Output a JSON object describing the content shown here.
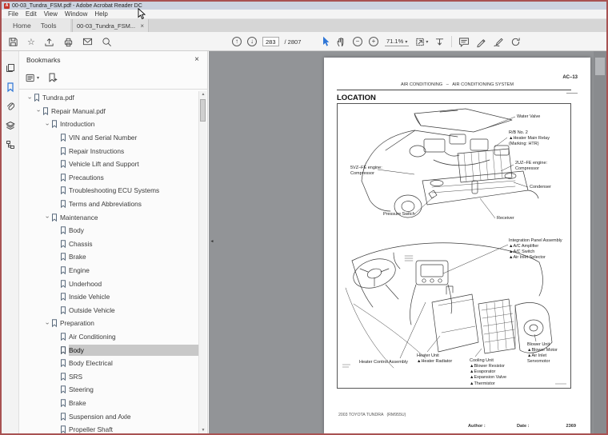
{
  "window": {
    "title": "00-03_Tundra_FSM.pdf - Adobe Acrobat Reader DC",
    "logo_letter": "A"
  },
  "menu_bar": {
    "items": [
      "File",
      "Edit",
      "View",
      "Window",
      "Help"
    ]
  },
  "tab_bar": {
    "home": "Home",
    "tools": "Tools",
    "document_tab": "00-03_Tundra_FSM...",
    "close_glyph": "×"
  },
  "toolbar": {
    "page_current": "283",
    "page_total": "/ 2807",
    "zoom_level": "71.1%"
  },
  "icons": {
    "close": "×",
    "caret_down": "▾",
    "chevron": "›",
    "arrow_up": "↑",
    "arrow_down": "↓",
    "minus": "−",
    "plus": "+",
    "star": "☆",
    "tri_up": "▲",
    "tri_down": "▼",
    "collapse_left": "◄"
  },
  "bookmarks": {
    "title": "Bookmarks",
    "items": [
      "Tundra.pdf",
      "Repair Manual.pdf",
      "Introduction",
      "VIN and Serial Number",
      "Repair Instructions",
      "Vehicle Lift and Support",
      "Precautions",
      "Troubleshooting ECU Systems",
      "Terms and Abbreviations",
      "Maintenance",
      "Body",
      "Chassis",
      "Brake",
      "Engine",
      "Underhood",
      "Inside Vehicle",
      "Outside Vehicle",
      "Preparation",
      "Air Conditioning",
      "Body",
      "Body Electrical",
      "SRS",
      "Steering",
      "Brake",
      "Suspension and Axle",
      "Propeller Shaft"
    ],
    "selected_item": "Body"
  },
  "document": {
    "page_code": "AC–13",
    "header": "AIR CONDITIONING   –   AIR CONDITIONING SYSTEM",
    "section_title": "LOCATION",
    "engine_labels": {
      "water_valve": "Water Valve",
      "relay_block": "R/B No. 2\n▲Heater Main Relay\n(Marking: HTR)",
      "engine_5vz": "5VZ–FE engine:\nCompressor",
      "engine_2uz": "2UZ–FE engine:\nCompressor",
      "condenser": "Condenser",
      "pressure_switch": "Pressure Switch",
      "receiver": "Receiver"
    },
    "cabin_labels": {
      "integration_panel": "Integration Panel Assembly\n▲A/C Amplifier\n▲A/C Switch\n▲Air Inlet Selector",
      "blower_unit": "Blower Unit\n▲Blower Motor\n▲Air Inlet Servomotor",
      "heater_control": "Heater Control Assembly",
      "heater_unit": "Heater Unit\n▲Heater Radiator",
      "cooling_unit": "Cooling Unit\n▲Blower Resistor\n▲Evaporator\n▲Expansion Valve\n▲Thermistor"
    },
    "footer_model": "2003 TOYOTA TUNDRA   (RM955U)",
    "footer_author": "Author :",
    "footer_date": "Date :",
    "footer_page": "2369"
  },
  "colors": {
    "window_border": "#a85252",
    "accent_blue": "#2f76d6",
    "selected_row": "#c8c8c8",
    "pane_gray": "#929497"
  }
}
